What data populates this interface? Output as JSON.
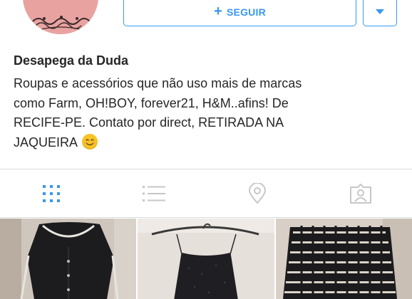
{
  "profile": {
    "name": "Desapega da Duda",
    "bio_lines": [
      "Roupas e acessórios que não uso mais de marcas",
      "como Farm, OH!BOY, forever21, H&M..afins! De",
      "RECIFE-PE. Contato por direct, RETIRADA NA",
      "JAQUEIRA"
    ]
  },
  "actions": {
    "follow_label": "SEGUIR",
    "follow_icon": "plus-icon",
    "dropdown_icon": "caret-down-icon"
  },
  "tabs": [
    {
      "id": "grid",
      "icon": "grid-icon",
      "active": true
    },
    {
      "id": "list",
      "icon": "list-icon",
      "active": false
    },
    {
      "id": "location",
      "icon": "location-pin-icon",
      "active": false
    },
    {
      "id": "tagged",
      "icon": "tagged-photos-icon",
      "active": false
    }
  ],
  "colors": {
    "accent": "#3897f0",
    "text": "#262626",
    "inactive_icon": "#c7c7c7",
    "divider": "#dbdbdb",
    "avatar": "#e8a3a0"
  },
  "grid_photos": [
    {
      "subject": "black blouse with white trim"
    },
    {
      "subject": "black sequined camisole on hanger"
    },
    {
      "subject": "black studded skirt"
    }
  ]
}
